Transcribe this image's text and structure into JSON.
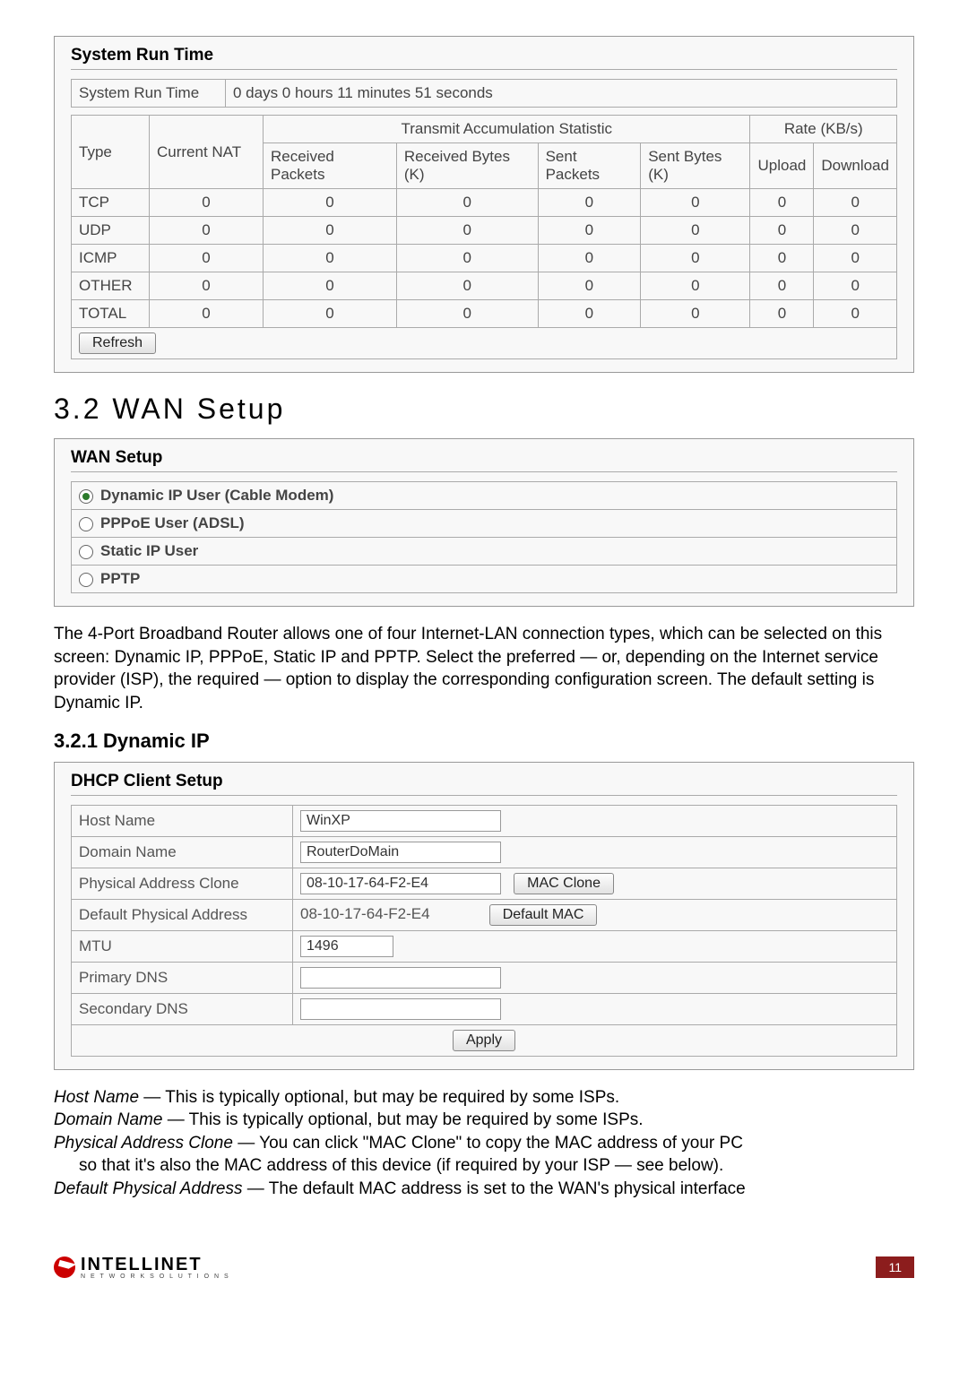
{
  "runtime_panel": {
    "title": "System Run Time",
    "label": "System Run Time",
    "value": "0 days  0 hours  11 minutes  51 seconds",
    "headers": {
      "type": "Type",
      "nat": "Current NAT",
      "trans_group": "Transmit Accumulation Statistic",
      "rate_group": "Rate (KB/s)",
      "rx_pkts": "Received Packets",
      "rx_bytes": "Received Bytes (K)",
      "tx_pkts": "Sent Packets",
      "tx_bytes": "Sent Bytes (K)",
      "upload": "Upload",
      "download": "Download"
    },
    "rows": [
      {
        "type": "TCP",
        "nat": "0",
        "rxp": "0",
        "rxb": "0",
        "txp": "0",
        "txb": "0",
        "up": "0",
        "dn": "0"
      },
      {
        "type": "UDP",
        "nat": "0",
        "rxp": "0",
        "rxb": "0",
        "txp": "0",
        "txb": "0",
        "up": "0",
        "dn": "0"
      },
      {
        "type": "ICMP",
        "nat": "0",
        "rxp": "0",
        "rxb": "0",
        "txp": "0",
        "txb": "0",
        "up": "0",
        "dn": "0"
      },
      {
        "type": "OTHER",
        "nat": "0",
        "rxp": "0",
        "rxb": "0",
        "txp": "0",
        "txb": "0",
        "up": "0",
        "dn": "0"
      },
      {
        "type": "TOTAL",
        "nat": "0",
        "rxp": "0",
        "rxb": "0",
        "txp": "0",
        "txb": "0",
        "up": "0",
        "dn": "0"
      }
    ],
    "refresh": "Refresh"
  },
  "section_heading": "3.2  WAN Setup",
  "wan_panel": {
    "title": "WAN Setup",
    "options": [
      {
        "label": "Dynamic IP User (Cable Modem)",
        "selected": true
      },
      {
        "label": "PPPoE User (ADSL)",
        "selected": false
      },
      {
        "label": "Static IP User",
        "selected": false
      },
      {
        "label": "PPTP",
        "selected": false
      }
    ]
  },
  "wan_text": "The 4-Port Broadband Router allows one of four Internet-LAN connection types, which can be selected on this screen: Dynamic IP,  PPPoE, Static IP and PPTP. Select the preferred — or, depending on the Internet service provider (ISP), the required — option to display the corresponding configuration screen. The default setting is Dynamic IP.",
  "sub_heading": "3.2.1  Dynamic IP",
  "dhcp_panel": {
    "title": "DHCP Client Setup",
    "labels": {
      "host": "Host Name",
      "domain": "Domain Name",
      "clone": "Physical Address Clone",
      "defmac": "Default Physical Address",
      "mtu": "MTU",
      "pdns": "Primary DNS",
      "sdns": "Secondary DNS"
    },
    "values": {
      "host": "WinXP",
      "domain": "RouterDoMain",
      "clone": "08-10-17-64-F2-E4",
      "defmac": "08-10-17-64-F2-E4",
      "mtu": "1496",
      "pdns": "",
      "sdns": ""
    },
    "buttons": {
      "macclone": "MAC  Clone",
      "defaultmac": "Default MAC",
      "apply": "Apply"
    }
  },
  "descriptions": {
    "l1a": "Host Name",
    "l1b": " — This is typically optional, but may be required by some ISPs.",
    "l2a": "Domain Name",
    "l2b": " — This is typically optional, but may be required by some ISPs.",
    "l3a": "Physical Address Clone",
    "l3b": " — You can click \"MAC Clone\" to copy the MAC address of your PC",
    "l3c": "so that it's also the MAC address of this device (if required by your ISP — see below).",
    "l4a": "Default Physical Address",
    "l4b": " — The default MAC address is set to the WAN's physical interface"
  },
  "footer": {
    "brand": "INTELLINET",
    "sub": "N E T W O R K   S O L U T I O N S",
    "page": "11"
  }
}
